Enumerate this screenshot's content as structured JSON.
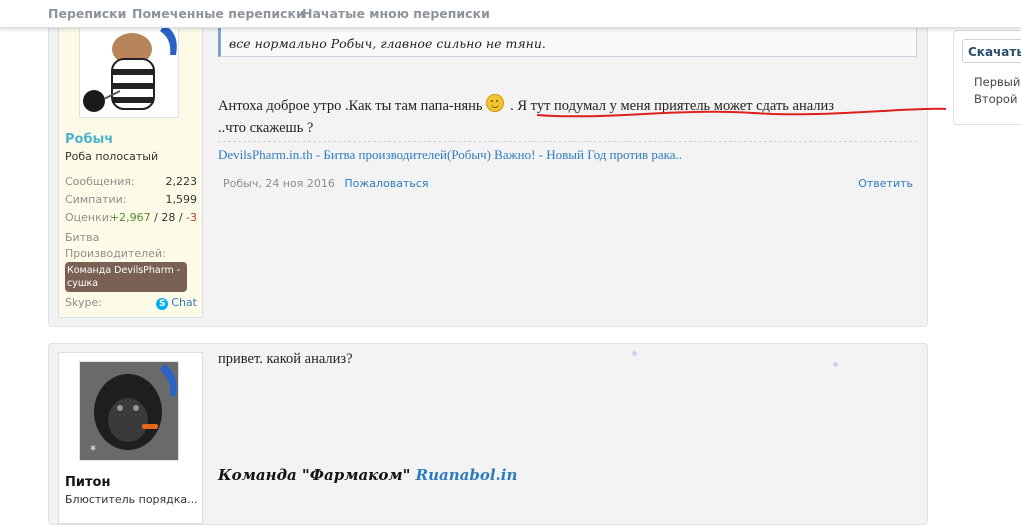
{
  "nav": {
    "tabs": [
      "Переписки",
      "Помеченные переписки",
      "Начатые мною переписки"
    ]
  },
  "sidebar": {
    "button_label": "Скачать",
    "items": [
      "Первый",
      "Второй"
    ]
  },
  "posts": [
    {
      "user": {
        "name": "Робыч",
        "title": "Роба полосатый",
        "name_color": "#4ab3cd",
        "stats": {
          "messages_label": "Сообщения:",
          "messages": "2,223",
          "likes_label": "Симпатии:",
          "likes": "1,599",
          "ratings_label": "Оценки:",
          "rating_pos": "+2,967",
          "rating_sep1": " / ",
          "rating_neutral": "28",
          "rating_sep2": " / ",
          "rating_neg": "-3"
        },
        "group_label": "Битва Производителей:",
        "badge": "Команда DevilsPharm - сушка",
        "skype_label": "Skype:",
        "skype_chat": "Chat"
      },
      "quote": "все нормально Робыч, главное сильно не тяни.",
      "message_part1": "Антоха доброе утро .Как ты там папа-нянь",
      "message_part2": " . Я тут подумал у меня приятель может сдать анализ",
      "message_part3": "..что скажешь ?",
      "signature": "DevilsPharm.in.th - Битва производителей(Робыч) Важно! - Новый Год против рака..",
      "meta_author_date": "Робыч, 24 ноя 2016",
      "report_label": "Пожаловаться",
      "reply_label": "Ответить"
    },
    {
      "user": {
        "name": "Питон",
        "title": "Блюститель порядка..."
      },
      "message": "привет. какой анализ?",
      "signature_text": "Команда \"Фармаком\" ",
      "signature_link": "Ruanabol.in"
    }
  ],
  "colors": {
    "accent_link": "#2f7bbf",
    "underline_mark": "#e0201c",
    "badge_bg": "#7a6154"
  }
}
